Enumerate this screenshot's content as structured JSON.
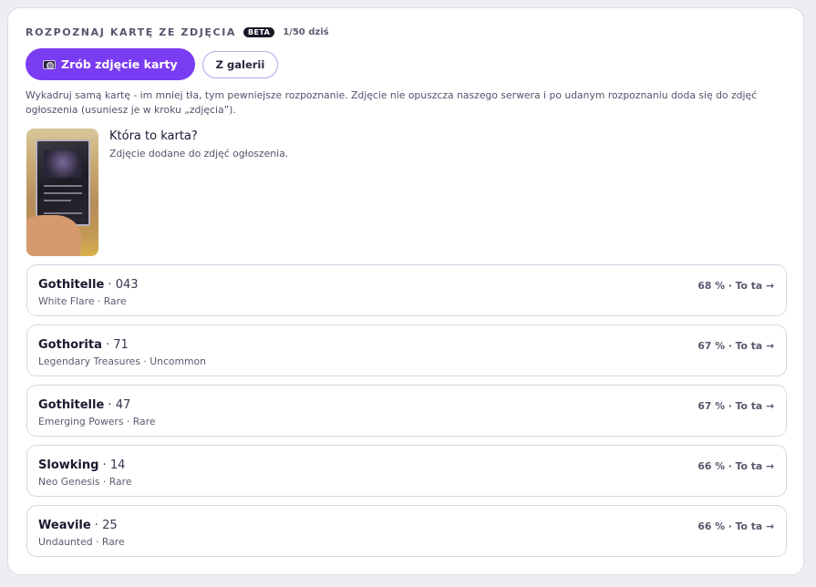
{
  "header": {
    "title": "ROZPOZNAJ KARTĘ ZE ZDJĘCIA",
    "badge": "BETA",
    "quota": "1/50 dziś"
  },
  "buttons": {
    "camera_label": "Zrób zdjęcie karty",
    "gallery_label": "Z galerii"
  },
  "hint": "Wykadruj samą kartę - im mniej tła, tym pewniejsze rozpoznanie. Zdjęcie nie opuszcza naszego serwera i po udanym rozpoznaniu doda się do zdjęć ogłoszenia (usuniesz je w kroku „zdjęcia”).",
  "preview": {
    "question": "Która to karta?",
    "note": "Zdjęcie dodane do zdjęć ogłoszenia."
  },
  "candidates": [
    {
      "name": "Gothitelle",
      "separator": " · ",
      "number": "043",
      "meta": "White Flare · Rare",
      "action": "68 % · To ta →"
    },
    {
      "name": "Gothorita",
      "separator": " · ",
      "number": "71",
      "meta": "Legendary Treasures · Uncommon",
      "action": "67 % · To ta →"
    },
    {
      "name": "Gothitelle",
      "separator": " · ",
      "number": "47",
      "meta": "Emerging Powers · Rare",
      "action": "67 % · To ta →"
    },
    {
      "name": "Slowking",
      "separator": " · ",
      "number": "14",
      "meta": "Neo Genesis · Rare",
      "action": "66 % · To ta →"
    },
    {
      "name": "Weavile",
      "separator": " · ",
      "number": "25",
      "meta": "Undaunted · Rare",
      "action": "66 % · To ta →"
    }
  ],
  "colors": {
    "accent": "#7a3cf2",
    "badge_bg": "#1a1726",
    "secondary_border": "#b9a3e6"
  },
  "icons": {
    "camera": "camera-icon"
  }
}
